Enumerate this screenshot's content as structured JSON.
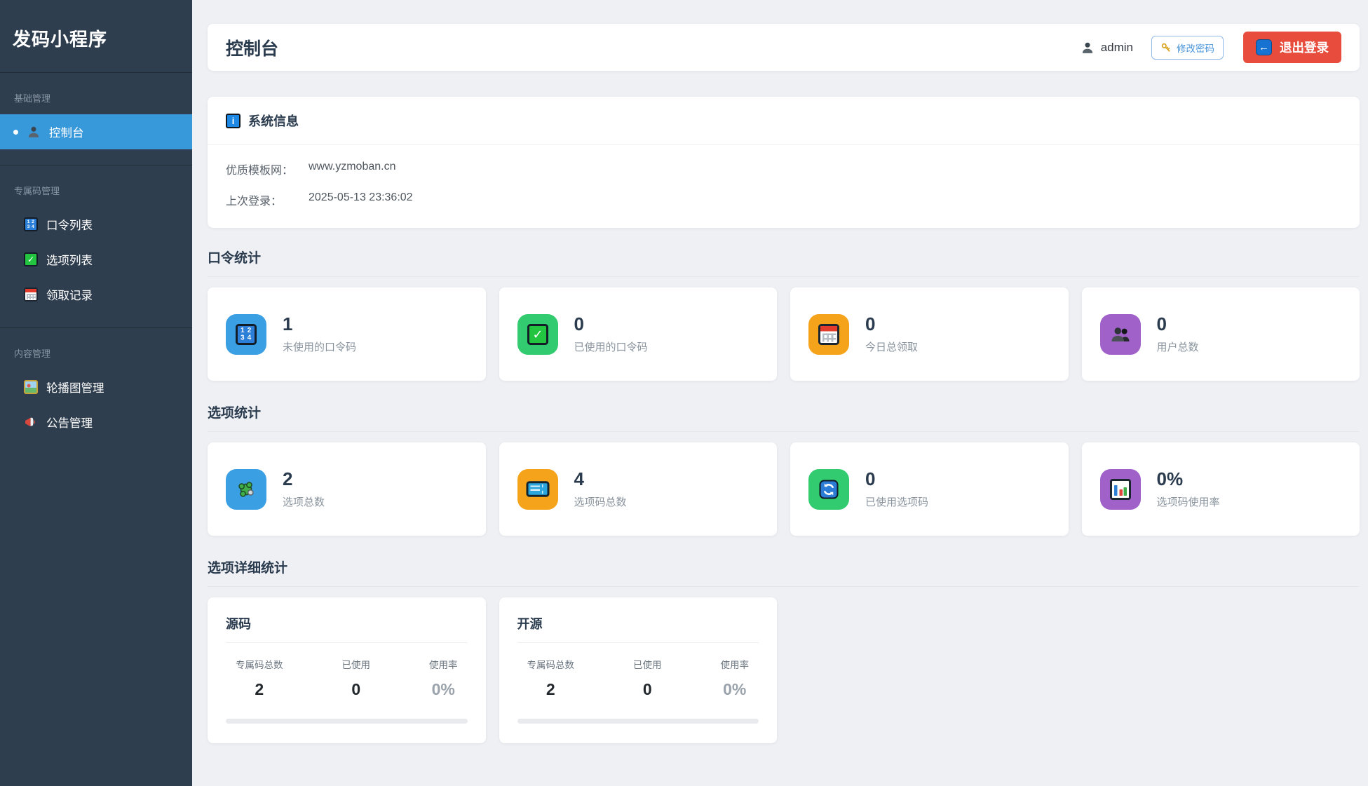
{
  "app": {
    "title": "发码小程序"
  },
  "colors": {
    "sidebar_bg": "#2f3e4e",
    "sidebar_active": "#3798da",
    "page_bg": "#eef0f4",
    "logout_red": "#e74c3c",
    "pwd_blue": "#4a96dc",
    "badge_blue": "#3b9fe3",
    "badge_green": "#33cb6f",
    "badge_orange": "#f5a31b",
    "badge_purple": "#a061c9"
  },
  "icons": {
    "numbers_row1": "1 2",
    "numbers_row2": "3 4",
    "check_glyph": "✓",
    "info_glyph": "i",
    "left_arrow_glyph": "←"
  },
  "sidebar": {
    "groups": [
      {
        "label": "基础管理",
        "items": [
          {
            "icon": "person",
            "label": "控制台",
            "active": true
          }
        ]
      },
      {
        "label": "专属码管理",
        "items": [
          {
            "icon": "input-numbers",
            "label": "口令列表"
          },
          {
            "icon": "check",
            "label": "选项列表"
          },
          {
            "icon": "calendar",
            "label": "领取记录"
          }
        ]
      },
      {
        "label": "内容管理",
        "items": [
          {
            "icon": "framed-picture",
            "label": "轮播图管理"
          },
          {
            "icon": "megaphone",
            "label": "公告管理"
          }
        ]
      }
    ]
  },
  "header": {
    "title": "控制台",
    "username": "admin",
    "change_password_label": "修改密码",
    "logout_label": "退出登录"
  },
  "system_info": {
    "title": "系统信息",
    "rows": [
      {
        "label": "优质模板网：",
        "value": "www.yzmoban.cn"
      },
      {
        "label": "上次登录：",
        "value": "2025-05-13 23:36:02"
      }
    ]
  },
  "sections": [
    {
      "heading": "口令统计",
      "cards": [
        {
          "icon": "input-numbers",
          "color": "blue",
          "value": "1",
          "label": "未使用的口令码"
        },
        {
          "icon": "check",
          "color": "green",
          "value": "0",
          "label": "已使用的口令码"
        },
        {
          "icon": "calendar",
          "color": "orange",
          "value": "0",
          "label": "今日总领取"
        },
        {
          "icon": "people",
          "color": "purple",
          "value": "0",
          "label": "用户总数"
        }
      ]
    },
    {
      "heading": "选项统计",
      "cards": [
        {
          "icon": "puzzle",
          "color": "blue",
          "value": "2",
          "label": "选项总数"
        },
        {
          "icon": "ticket",
          "color": "orange",
          "value": "4",
          "label": "选项码总数"
        },
        {
          "icon": "refresh",
          "color": "green",
          "value": "0",
          "label": "已使用选项码"
        },
        {
          "icon": "bar-chart",
          "color": "purple",
          "value": "0%",
          "label": "选项码使用率"
        }
      ]
    }
  ],
  "detail_section": {
    "heading": "选项详细统计",
    "cards": [
      {
        "title": "源码",
        "columns": [
          {
            "label": "专属码总数",
            "value": "2"
          },
          {
            "label": "已使用",
            "value": "0"
          },
          {
            "label": "使用率",
            "value": "0%"
          }
        ],
        "progress_percent": 0
      },
      {
        "title": "开源",
        "columns": [
          {
            "label": "专属码总数",
            "value": "2"
          },
          {
            "label": "已使用",
            "value": "0"
          },
          {
            "label": "使用率",
            "value": "0%"
          }
        ],
        "progress_percent": 0
      }
    ]
  }
}
